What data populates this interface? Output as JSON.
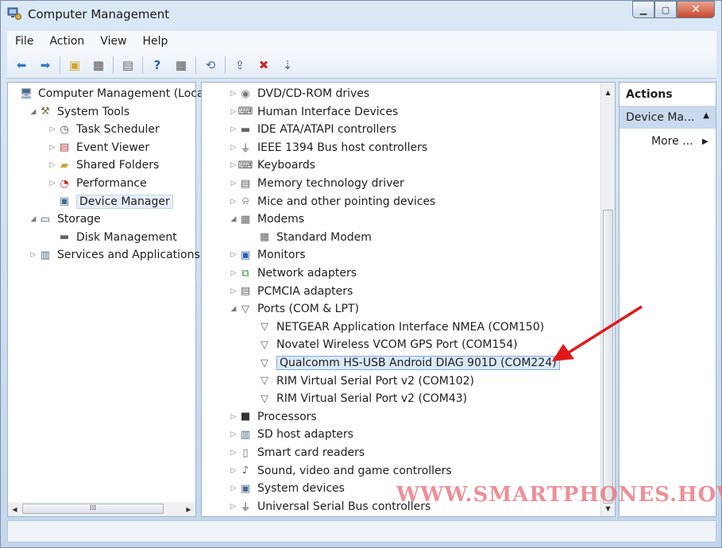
{
  "window": {
    "title": "Computer Management"
  },
  "menu": [
    "File",
    "Action",
    "View",
    "Help"
  ],
  "left_tree": [
    {
      "label": "Computer Management (Local",
      "level": 0,
      "expander": "",
      "icon": "computer-management-icon"
    },
    {
      "label": "System Tools",
      "level": 1,
      "expander": "open",
      "icon": "tools-icon"
    },
    {
      "label": "Task Scheduler",
      "level": 2,
      "expander": "closed",
      "icon": "clock-icon"
    },
    {
      "label": "Event Viewer",
      "level": 2,
      "expander": "closed",
      "icon": "event-viewer-icon"
    },
    {
      "label": "Shared Folders",
      "level": 2,
      "expander": "closed",
      "icon": "shared-folder-icon"
    },
    {
      "label": "Performance",
      "level": 2,
      "expander": "closed",
      "icon": "performance-icon"
    },
    {
      "label": "Device Manager",
      "level": 2,
      "expander": "",
      "icon": "device-manager-icon",
      "selected": true
    },
    {
      "label": "Storage",
      "level": 1,
      "expander": "open",
      "icon": "storage-icon"
    },
    {
      "label": "Disk Management",
      "level": 2,
      "expander": "",
      "icon": "disk-icon"
    },
    {
      "label": "Services and Applications",
      "level": 1,
      "expander": "closed",
      "icon": "services-icon"
    }
  ],
  "device_tree": [
    {
      "label": "DVD/CD-ROM drives",
      "level": 0,
      "expander": "closed",
      "icon": "dvd-drive-icon"
    },
    {
      "label": "Human Interface Devices",
      "level": 0,
      "expander": "closed",
      "icon": "hid-icon"
    },
    {
      "label": "IDE ATA/ATAPI controllers",
      "level": 0,
      "expander": "closed",
      "icon": "ide-controller-icon"
    },
    {
      "label": "IEEE 1394 Bus host controllers",
      "level": 0,
      "expander": "closed",
      "icon": "ieee1394-icon"
    },
    {
      "label": "Keyboards",
      "level": 0,
      "expander": "closed",
      "icon": "keyboard-icon"
    },
    {
      "label": "Memory technology driver",
      "level": 0,
      "expander": "closed",
      "icon": "memory-icon"
    },
    {
      "label": "Mice and other pointing devices",
      "level": 0,
      "expander": "closed",
      "icon": "mouse-icon"
    },
    {
      "label": "Modems",
      "level": 0,
      "expander": "open",
      "icon": "modem-icon"
    },
    {
      "label": "Standard Modem",
      "level": 1,
      "expander": "",
      "icon": "modem-icon"
    },
    {
      "label": "Monitors",
      "level": 0,
      "expander": "closed",
      "icon": "monitor-icon"
    },
    {
      "label": "Network adapters",
      "level": 0,
      "expander": "closed",
      "icon": "network-adapter-icon"
    },
    {
      "label": "PCMCIA adapters",
      "level": 0,
      "expander": "closed",
      "icon": "pcmcia-icon"
    },
    {
      "label": "Ports (COM & LPT)",
      "level": 0,
      "expander": "open",
      "icon": "port-icon"
    },
    {
      "label": "NETGEAR Application Interface NMEA (COM150)",
      "level": 1,
      "expander": "",
      "icon": "port-icon"
    },
    {
      "label": "Novatel Wireless VCOM GPS Port (COM154)",
      "level": 1,
      "expander": "",
      "icon": "port-icon"
    },
    {
      "label": "Qualcomm HS-USB Android DIAG 901D (COM224)",
      "level": 1,
      "expander": "",
      "icon": "port-icon",
      "highlighted": true
    },
    {
      "label": "RIM Virtual Serial Port v2 (COM102)",
      "level": 1,
      "expander": "",
      "icon": "port-icon"
    },
    {
      "label": "RIM Virtual Serial Port v2 (COM43)",
      "level": 1,
      "expander": "",
      "icon": "port-icon"
    },
    {
      "label": "Processors",
      "level": 0,
      "expander": "closed",
      "icon": "processor-icon"
    },
    {
      "label": "SD host adapters",
      "level": 0,
      "expander": "closed",
      "icon": "sd-adapter-icon"
    },
    {
      "label": "Smart card readers",
      "level": 0,
      "expander": "closed",
      "icon": "smart-card-icon"
    },
    {
      "label": "Sound, video and game controllers",
      "level": 0,
      "expander": "closed",
      "icon": "sound-icon"
    },
    {
      "label": "System devices",
      "level": 0,
      "expander": "closed",
      "icon": "system-devices-icon"
    },
    {
      "label": "Universal Serial Bus controllers",
      "level": 0,
      "expander": "closed",
      "icon": "usb-icon"
    }
  ],
  "actions": {
    "title": "Actions",
    "group": "Device Ma...",
    "more": "More ..."
  },
  "watermark": "WWW.SMARTPHONES.HOW",
  "colors": {
    "annotation_arrow": "#e0191b",
    "selection": "#dbe8f7",
    "watermark": "#e97880"
  }
}
